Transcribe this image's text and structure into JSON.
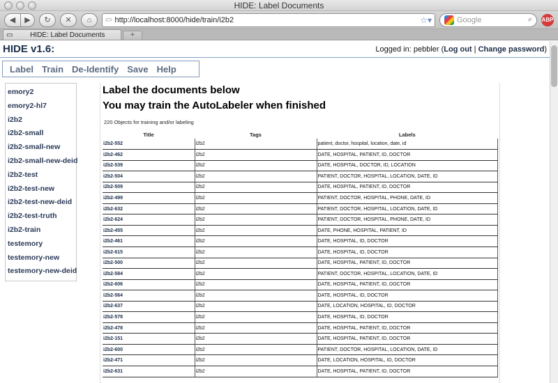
{
  "window": {
    "title": "HIDE: Label Documents"
  },
  "browser": {
    "url": "http://localhost:8000/hide/train/i2b2",
    "search_placeholder": "Google",
    "tab_label": "HIDE: Label Documents",
    "newtab_label": "+",
    "adblock_label": "ABP"
  },
  "app": {
    "title": "HIDE v1.6:",
    "login_prefix": "Logged in: pebbler (",
    "logout_label": "Log out",
    "separator": " | ",
    "change_password_label": "Change password",
    "login_suffix": ")"
  },
  "menu": [
    "Label",
    "Train",
    "De-Identify",
    "Save",
    "Help"
  ],
  "sidebar": [
    "emory2",
    "emory2-hl7",
    "i2b2",
    "i2b2-small",
    "i2b2-small-new",
    "i2b2-small-new-deid",
    "i2b2-test",
    "i2b2-test-new",
    "i2b2-test-new-deid",
    "i2b2-test-truth",
    "i2b2-train",
    "testemory",
    "testemory-new",
    "testemory-new-deid"
  ],
  "main": {
    "heading1": "Label the documents below",
    "heading2": "You may train the AutoLabeler when finished",
    "count_text": "220 Objects for training and/or labeling",
    "columns": [
      "Title",
      "Tags",
      "Labels"
    ],
    "rows": [
      [
        "i2b2-552",
        "i2b2",
        "patient, doctor, hospital, location, date, id"
      ],
      [
        "i2b2-462",
        "i2b2",
        "DATE, HOSPITAL, PATIENT, ID, DOCTOR"
      ],
      [
        "i2b2-539",
        "i2b2",
        "DATE, HOSPITAL, DOCTOR, ID, LOCATION"
      ],
      [
        "i2b2-504",
        "i2b2",
        "PATIENT, DOCTOR, HOSPITAL, LOCATION, DATE, ID"
      ],
      [
        "i2b2-509",
        "i2b2",
        "DATE, HOSPITAL, PATIENT, ID, DOCTOR"
      ],
      [
        "i2b2-499",
        "i2b2",
        "PATIENT, DOCTOR, HOSPITAL, PHONE, DATE, ID"
      ],
      [
        "i2b2-632",
        "i2b2",
        "PATIENT, DOCTOR, HOSPITAL, LOCATION, DATE, ID"
      ],
      [
        "i2b2-624",
        "i2b2",
        "PATIENT, DOCTOR, HOSPITAL, PHONE, DATE, ID"
      ],
      [
        "i2b2-455",
        "i2b2",
        "DATE, PHONE, HOSPITAL, PATIENT, ID"
      ],
      [
        "i2b2-461",
        "i2b2",
        "DATE, HOSPITAL, ID, DOCTOR"
      ],
      [
        "i2b2-615",
        "i2b2",
        "DATE, HOSPITAL, ID, DOCTOR"
      ],
      [
        "i2b2-500",
        "i2b2",
        "DATE, HOSPITAL, PATIENT, ID, DOCTOR"
      ],
      [
        "i2b2-584",
        "i2b2",
        "PATIENT, DOCTOR, HOSPITAL, LOCATION, DATE, ID"
      ],
      [
        "i2b2-606",
        "i2b2",
        "DATE, HOSPITAL, PATIENT, ID, DOCTOR"
      ],
      [
        "i2b2-564",
        "i2b2",
        "DATE, HOSPITAL, ID, DOCTOR"
      ],
      [
        "i2b2-637",
        "i2b2",
        "DATE, LOCATION, HOSPITAL, ID, DOCTOR"
      ],
      [
        "i2b2-578",
        "i2b2",
        "DATE, HOSPITAL, ID, DOCTOR"
      ],
      [
        "i2b2-478",
        "i2b2",
        "DATE, HOSPITAL, PATIENT, ID, DOCTOR"
      ],
      [
        "i2b2-151",
        "i2b2",
        "DATE, HOSPITAL, PATIENT, ID, DOCTOR"
      ],
      [
        "i2b2-600",
        "i2b2",
        "PATIENT, DOCTOR, HOSPITAL, LOCATION, DATE, ID"
      ],
      [
        "i2b2-471",
        "i2b2",
        "DATE, LOCATION, HOSPITAL, ID, DOCTOR"
      ],
      [
        "i2b2-631",
        "i2b2",
        "DATE, HOSPITAL, PATIENT, ID, DOCTOR"
      ]
    ]
  },
  "colors": {
    "nav_text": "#5b6b82",
    "link": "#1c2e4a",
    "border": "#7f98b8"
  }
}
